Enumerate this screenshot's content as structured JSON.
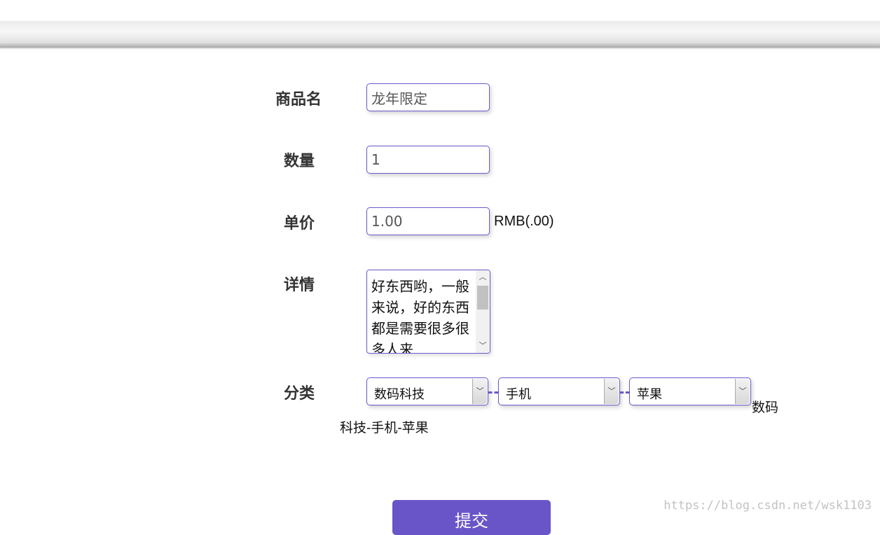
{
  "form": {
    "name_label": "商品名",
    "name_value": "龙年限定",
    "quantity_label": "数量",
    "quantity_value": "1",
    "price_label": "单价",
    "price_value": "1.00",
    "price_unit": "RMB(.00)",
    "detail_label": "详情",
    "detail_value": "好东西哟，一般来说，好的东西都是需要很多很多人来",
    "category_label": "分类",
    "category_1": "数码科技",
    "category_2": "手机",
    "category_3": "苹果",
    "category_result_part1": "数码",
    "category_result_part2": "科技-手机-苹果",
    "submit_label": "提交"
  },
  "watermark": "https://blog.csdn.net/wsk1103",
  "colors": {
    "accent": "#6a5acd",
    "button": "#6a55c8"
  }
}
